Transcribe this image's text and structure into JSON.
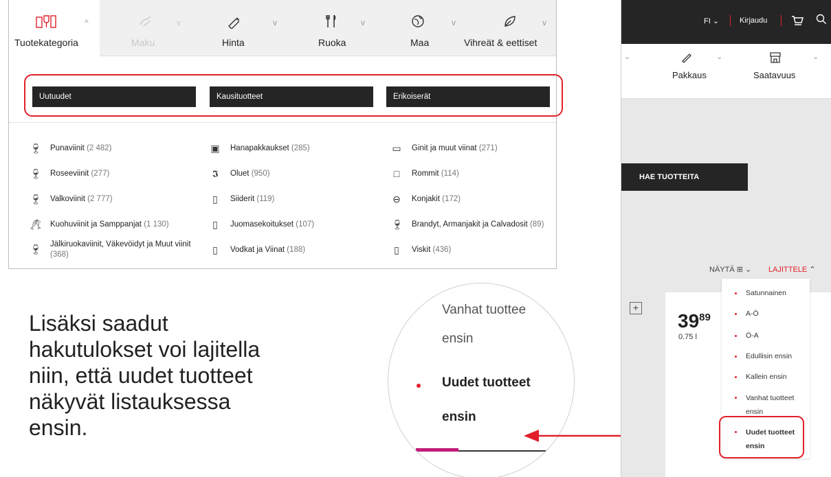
{
  "tabs": [
    {
      "label": "Tuotekategoria",
      "icon": "wine-glasses-icon",
      "chevron": "^",
      "active": true
    },
    {
      "label": "Maku",
      "icon": "taste-icon",
      "chevron": "v",
      "disabled": true
    },
    {
      "label": "Hinta",
      "icon": "price-tag-icon",
      "chevron": "v"
    },
    {
      "label": "Ruoka",
      "icon": "fork-knife-icon",
      "chevron": "v"
    },
    {
      "label": "Maa",
      "icon": "globe-icon",
      "chevron": "v"
    },
    {
      "label": "Vihreät & eettiset",
      "icon": "leaf-icon",
      "chevron": "v"
    }
  ],
  "category_buttons": [
    "Uutuudet",
    "Kausituotteet",
    "Erikoiserät"
  ],
  "categories": [
    {
      "name": "Punaviinit",
      "count": "(2 482)"
    },
    {
      "name": "Roseeviinit",
      "count": "(277)"
    },
    {
      "name": "Valkoviinit",
      "count": "(2 777)"
    },
    {
      "name": "Kuohuviinit ja Samppanjat",
      "count": "(1 130)"
    },
    {
      "name": "Jälkiruokaviinit, Väkevöidyt ja Muut viinit",
      "count": "(368)"
    },
    {
      "name": "Hanapakkaukset",
      "count": "(285)"
    },
    {
      "name": "Oluet",
      "count": "(950)"
    },
    {
      "name": "Siiderit",
      "count": "(119)"
    },
    {
      "name": "Juomasekoitukset",
      "count": "(107)"
    },
    {
      "name": "Vodkat ja Viinat",
      "count": "(188)"
    },
    {
      "name": "Ginit ja muut viinat",
      "count": "(271)"
    },
    {
      "name": "Rommit",
      "count": "(114)"
    },
    {
      "name": "Konjakit",
      "count": "(172)"
    },
    {
      "name": "Brandyt, Armanjakit ja Calvadosit",
      "count": "(89)"
    },
    {
      "name": "Viskit",
      "count": "(436)"
    }
  ],
  "caption": "Lisäksi saadut hakutulokset voi lajitella niin, että uudet tuotteet näkyvät listauksessa ensin.",
  "magnifier": {
    "line1": "Vanhat tuottee",
    "line2": "ensin",
    "line3": "Uudet tuotteet",
    "line4": "ensin"
  },
  "topbar": {
    "lang": "FI",
    "login": "Kirjaudu"
  },
  "right_tabs": [
    {
      "label": "Pakkaus",
      "icon": "package-icon"
    },
    {
      "label": "Saatavuus",
      "icon": "store-icon"
    }
  ],
  "search_button": "HAE TUOTTEITA",
  "show_label": "NÄYTÄ",
  "sort_label": "LAJITTELE",
  "sort_options": [
    "Satunnainen",
    "A-Ö",
    "Ö-A",
    "Edullisin ensin",
    "Kallein ensin",
    "Vanhat tuotteet ensin",
    "Uudet tuotteet ensin"
  ],
  "product": {
    "price_int": "39",
    "price_dec": "89",
    "volume": "0.75 l"
  },
  "colors": {
    "accent": "#e2202a",
    "dark": "#252525",
    "magenta": "#c21a7a"
  }
}
